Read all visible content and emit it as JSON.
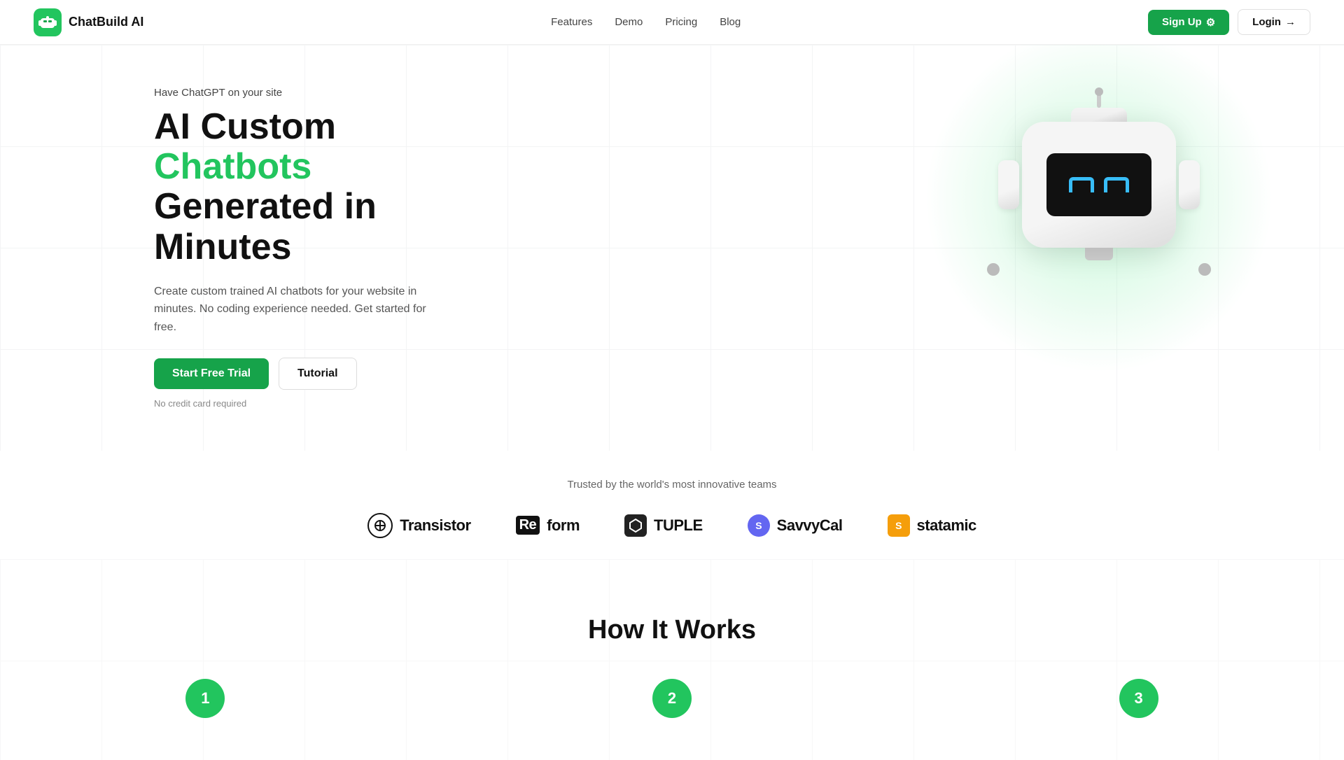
{
  "nav": {
    "logo_icon": "🤖",
    "logo_text": "ChatBuild AI",
    "links": [
      {
        "label": "Features",
        "href": "#"
      },
      {
        "label": "Demo",
        "href": "#"
      },
      {
        "label": "Pricing",
        "href": "#"
      },
      {
        "label": "Blog",
        "href": "#"
      }
    ],
    "signup_label": "Sign Up",
    "login_label": "Login"
  },
  "hero": {
    "eyebrow": "Have ChatGPT on your site",
    "title_part1": "AI Custom ",
    "title_highlight": "Chatbots",
    "title_part2": "Generated in Minutes",
    "description": "Create custom trained AI chatbots for your website in minutes. No coding experience needed. Get started for free.",
    "cta_primary": "Start Free Trial",
    "cta_secondary": "Tutorial",
    "note": "No credit card required"
  },
  "trusted": {
    "label": "Trusted by the world's most innovative teams",
    "logos": [
      {
        "name": "Transistor",
        "type": "transistor"
      },
      {
        "name": "Reform",
        "type": "reform"
      },
      {
        "name": "TUPLE",
        "type": "tuple"
      },
      {
        "name": "SavvyCal",
        "type": "savvycal"
      },
      {
        "name": "statamic",
        "type": "statamic"
      }
    ]
  },
  "how": {
    "title": "How It Works",
    "steps": [
      {
        "number": "1"
      },
      {
        "number": "2"
      },
      {
        "number": "3"
      }
    ]
  },
  "colors": {
    "green": "#22c55e",
    "green_dark": "#16a34a",
    "blue_eye": "#38bdf8"
  }
}
